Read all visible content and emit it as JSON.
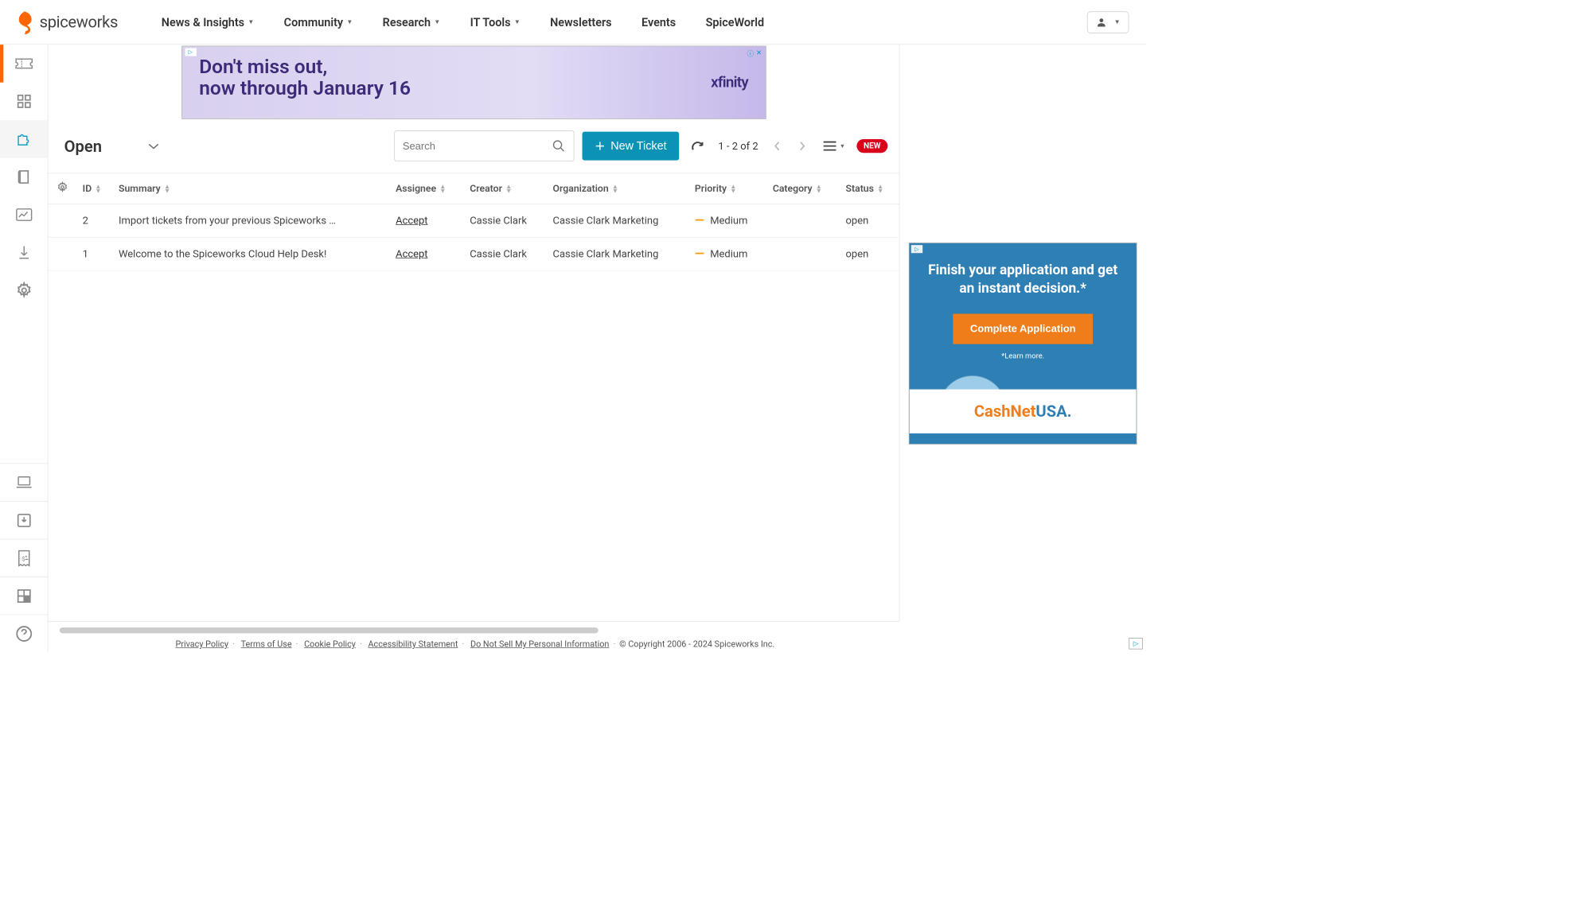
{
  "brand": "spiceworks",
  "nav": {
    "items": [
      {
        "label": "News & Insights",
        "dropdown": true
      },
      {
        "label": "Community",
        "dropdown": true
      },
      {
        "label": "Research",
        "dropdown": true
      },
      {
        "label": "IT Tools",
        "dropdown": true
      },
      {
        "label": "Newsletters",
        "dropdown": false
      },
      {
        "label": "Events",
        "dropdown": false
      },
      {
        "label": "SpiceWorld",
        "dropdown": false
      }
    ]
  },
  "banner": {
    "line1": "Don't miss out,",
    "line2": "now through January 16",
    "brand": "xfinity"
  },
  "toolbar": {
    "filter": "Open",
    "search_placeholder": "Search",
    "new_ticket": "New Ticket",
    "pager": "1 - 2 of 2",
    "new_badge": "NEW"
  },
  "table": {
    "columns": [
      "ID",
      "Summary",
      "Assignee",
      "Creator",
      "Organization",
      "Priority",
      "Category",
      "Status"
    ],
    "accept_label": "Accept",
    "rows": [
      {
        "id": "2",
        "summary": "Import tickets from your previous Spiceworks …",
        "creator": "Cassie Clark",
        "organization": "Cassie Clark Marketing",
        "priority": "Medium",
        "category": "",
        "status": "open"
      },
      {
        "id": "1",
        "summary": "Welcome to the Spiceworks Cloud Help Desk!",
        "creator": "Cassie Clark",
        "organization": "Cassie Clark Marketing",
        "priority": "Medium",
        "category": "",
        "status": "open"
      }
    ]
  },
  "right_ad": {
    "title": "Finish your application and get an instant decision.*",
    "button": "Complete Application",
    "learn": "*Learn more.",
    "brand1": "CashNet",
    "brand2": "USA"
  },
  "footer": {
    "links": [
      "Privacy Policy",
      "Terms of Use",
      "Cookie Policy",
      "Accessibility Statement",
      "Do Not Sell My Personal Information"
    ],
    "copyright": "© Copyright 2006 - 2024 Spiceworks Inc."
  }
}
